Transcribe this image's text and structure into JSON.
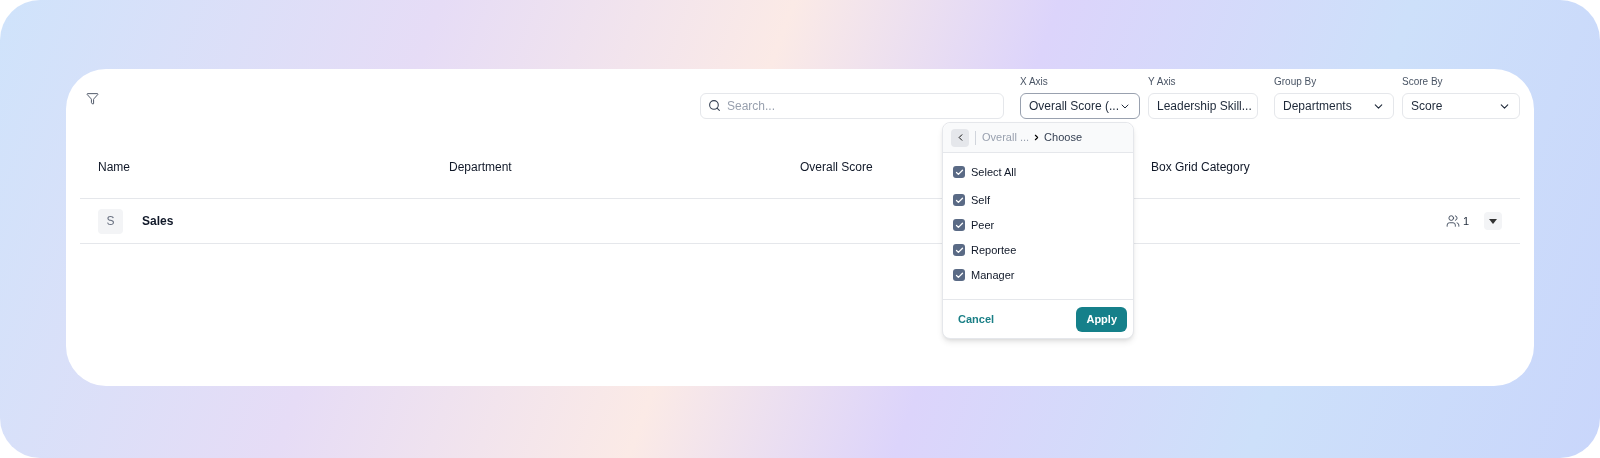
{
  "search": {
    "placeholder": "Search..."
  },
  "filters": [
    {
      "label": "X Axis",
      "value": "Overall Score (...",
      "open": true
    },
    {
      "label": "Y Axis",
      "value": "Leadership Skill...",
      "open": false
    },
    {
      "label": "Group By",
      "value": "Departments",
      "open": false
    },
    {
      "label": "Score By",
      "value": "Score",
      "open": false
    }
  ],
  "table": {
    "columns": [
      "Name",
      "Department",
      "Overall Score",
      "Box Grid Category"
    ],
    "rows": [
      {
        "avatar": "S",
        "name": "Sales",
        "members": "1"
      }
    ]
  },
  "popup": {
    "breadcrumb": "Overall ...",
    "current": "Choose",
    "options": [
      {
        "label": "Select All",
        "checked": true
      },
      {
        "label": "Self",
        "checked": true
      },
      {
        "label": "Peer",
        "checked": true
      },
      {
        "label": "Reportee",
        "checked": true
      },
      {
        "label": "Manager",
        "checked": true
      }
    ],
    "cancel": "Cancel",
    "apply": "Apply"
  }
}
